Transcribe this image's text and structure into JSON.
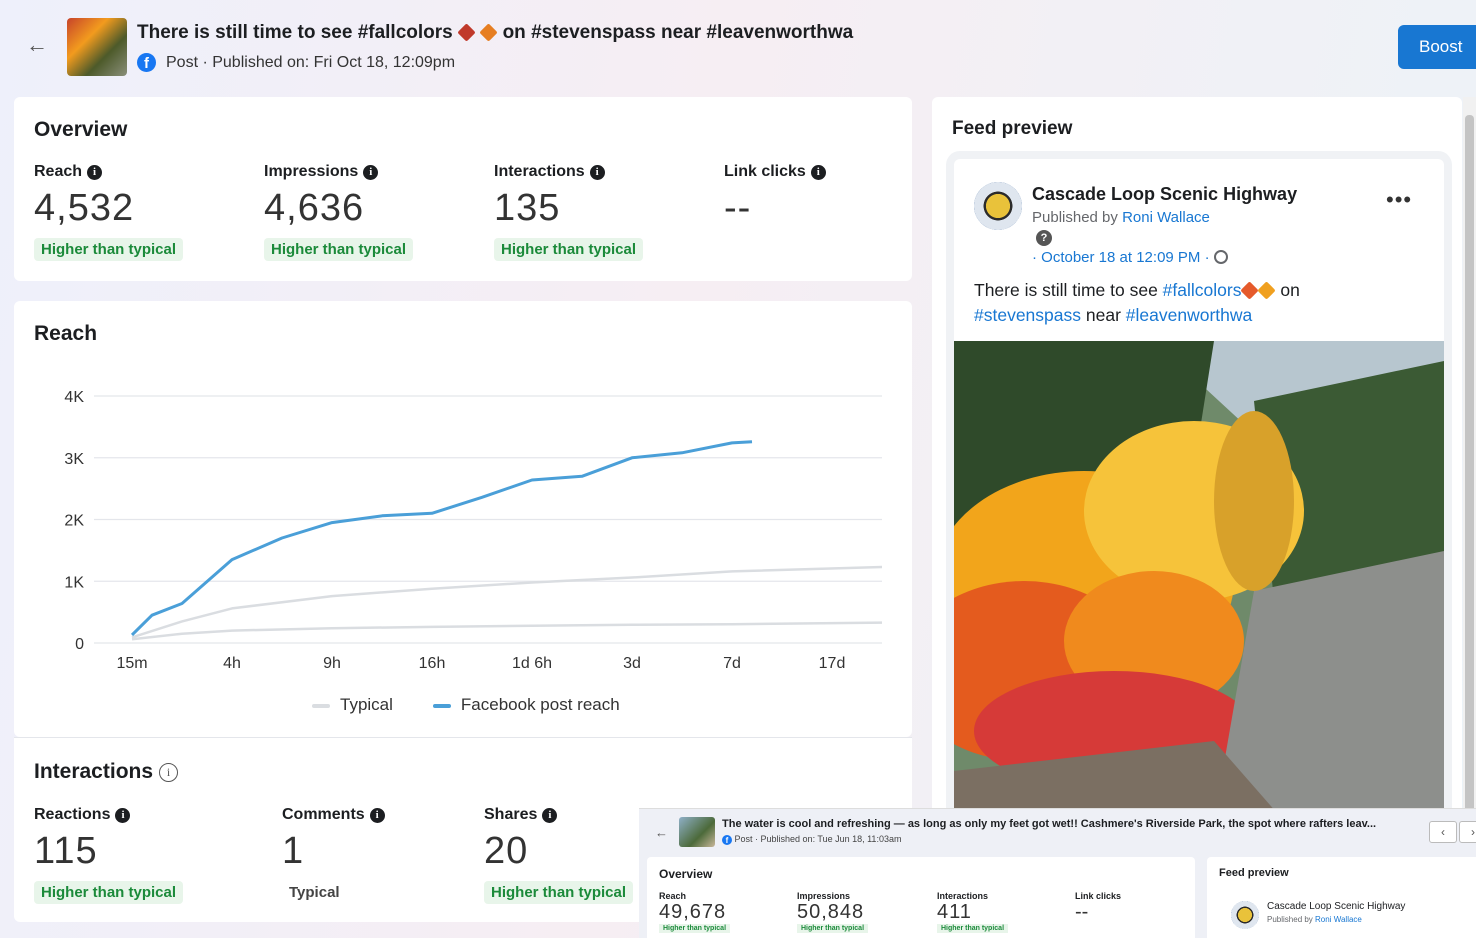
{
  "header": {
    "title_pre": "There is still time to see #fallcolors",
    "title_post": "on #stevenspass near #leavenworthwa",
    "subtitle": "Post · Published on: Fri Oct 18, 12:09pm",
    "boost_label": "Boost",
    "icons": [
      "back-arrow-icon",
      "facebook-icon",
      "maple-leaf-icon",
      "fallen-leaf-icon"
    ]
  },
  "overview": {
    "title": "Overview",
    "metrics": [
      {
        "label": "Reach",
        "value": "4,532",
        "badge": "Higher than typical"
      },
      {
        "label": "Impressions",
        "value": "4,636",
        "badge": "Higher than typical"
      },
      {
        "label": "Interactions",
        "value": "135",
        "badge": "Higher than typical"
      },
      {
        "label": "Link clicks",
        "value": "--",
        "badge": ""
      }
    ]
  },
  "reach": {
    "title": "Reach",
    "legend": [
      "Typical",
      "Facebook post reach"
    ]
  },
  "chart_data": {
    "type": "line",
    "title": "Reach",
    "xlabel": "",
    "ylabel": "",
    "x_ticks": [
      "15m",
      "4h",
      "9h",
      "16h",
      "1d 6h",
      "3d",
      "7d",
      "17d"
    ],
    "y_ticks": [
      "0",
      "1K",
      "2K",
      "3K",
      "4K"
    ],
    "ylim": [
      0,
      4000
    ],
    "grid": true,
    "legend_position": "bottom",
    "colors": {
      "Typical": "#dadde1",
      "Facebook post reach": "#4a9fd8"
    },
    "series": [
      {
        "name": "Facebook post reach",
        "x": [
          0,
          0.2,
          0.5,
          1,
          1.5,
          2,
          2.5,
          3,
          3.5,
          4,
          4.5,
          5,
          5.5,
          6,
          6.2
        ],
        "values": [
          130,
          450,
          640,
          1350,
          1700,
          1950,
          2060,
          2100,
          2360,
          2640,
          2700,
          3000,
          3080,
          3240,
          3260
        ]
      },
      {
        "name": "Typical",
        "x": [
          0,
          0.5,
          1,
          2,
          3,
          4,
          5,
          6,
          7.5
        ],
        "values": [
          90,
          350,
          560,
          760,
          880,
          980,
          1060,
          1160,
          1230
        ]
      },
      {
        "name": "Typical",
        "x": [
          0,
          0.5,
          1,
          2,
          3,
          4,
          5,
          6,
          7.5
        ],
        "values": [
          60,
          150,
          200,
          240,
          260,
          280,
          295,
          305,
          330
        ]
      }
    ]
  },
  "interactions": {
    "title": "Interactions",
    "metrics": [
      {
        "label": "Reactions",
        "value": "115",
        "badge": "Higher than typical"
      },
      {
        "label": "Comments",
        "value": "1",
        "badge": "Typical"
      },
      {
        "label": "Shares",
        "value": "20",
        "badge": "Higher than typical"
      }
    ]
  },
  "feed": {
    "title": "Feed preview",
    "page_name": "Cascade Loop Scenic Highway",
    "published_by_prefix": "Published by ",
    "author": "Roni Wallace",
    "date": "· October 18 at 12:09 PM ·",
    "text_pre": "There is still time to see ",
    "hashtag1": "#fallcolors",
    "text_on": " on",
    "hashtag2": "#stevenspass",
    "text_near": " near ",
    "hashtag3": "#leavenworthwa"
  },
  "inset": {
    "title": "The water is cool and refreshing — as long as only my feet got wet!! Cashmere's Riverside Park, the spot where rafters leav...",
    "subtitle": "Post · Published on: Tue Jun 18, 11:03am",
    "overview_title": "Overview",
    "metrics": [
      {
        "label": "Reach",
        "value": "49,678",
        "badge": "Higher than typical"
      },
      {
        "label": "Impressions",
        "value": "50,848",
        "badge": "Higher than typical"
      },
      {
        "label": "Interactions",
        "value": "411",
        "badge": "Higher than typical"
      },
      {
        "label": "Link clicks",
        "value": "--",
        "badge": ""
      }
    ],
    "feed_title": "Feed preview",
    "page_name": "Cascade Loop Scenic Highway",
    "published_by_prefix": "Published by ",
    "author": "Roni Wallace"
  }
}
